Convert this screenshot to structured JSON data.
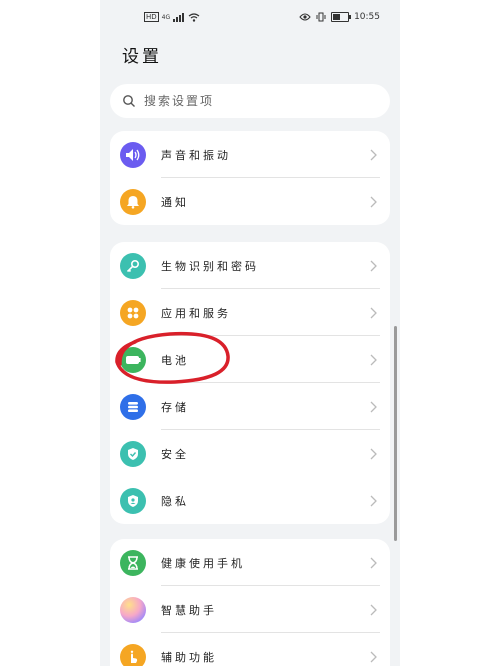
{
  "status_bar": {
    "left_badge": "HD",
    "network": "4G",
    "time": "10:55",
    "icons": [
      "hd-badge",
      "signal-icon",
      "wifi-icon",
      "eye-comfort-icon",
      "vibrate-icon",
      "battery-icon"
    ],
    "battery_level": 0.5
  },
  "page": {
    "title": "设置"
  },
  "search": {
    "placeholder": "搜索设置项"
  },
  "groups": [
    {
      "items": [
        {
          "label": "声音和振动",
          "icon": "speaker-icon",
          "color": "#6b5cf0"
        },
        {
          "label": "通知",
          "icon": "bell-icon",
          "color": "#f5a623"
        }
      ]
    },
    {
      "items": [
        {
          "label": "生物识别和密码",
          "icon": "key-icon",
          "color": "#3cc0b0"
        },
        {
          "label": "应用和服务",
          "icon": "apps-icon",
          "color": "#f5a623"
        },
        {
          "label": "电池",
          "icon": "battery-icon",
          "color": "#3cb55e"
        },
        {
          "label": "存储",
          "icon": "storage-icon",
          "color": "#2f6fe8"
        },
        {
          "label": "安全",
          "icon": "shield-check-icon",
          "color": "#3cc0b0"
        },
        {
          "label": "隐私",
          "icon": "privacy-shield-icon",
          "color": "#3cc0b0"
        }
      ]
    },
    {
      "items": [
        {
          "label": "健康使用手机",
          "icon": "hourglass-icon",
          "color": "#3cb55e"
        },
        {
          "label": "智慧助手",
          "icon": "assistant-orb-icon",
          "color": "#c58ff2"
        },
        {
          "label": "辅助功能",
          "icon": "accessibility-hand-icon",
          "color": "#f5a623"
        }
      ]
    }
  ],
  "colors": {
    "highlight": "#d9202a",
    "background": "#f1f3f5",
    "card": "#ffffff"
  }
}
